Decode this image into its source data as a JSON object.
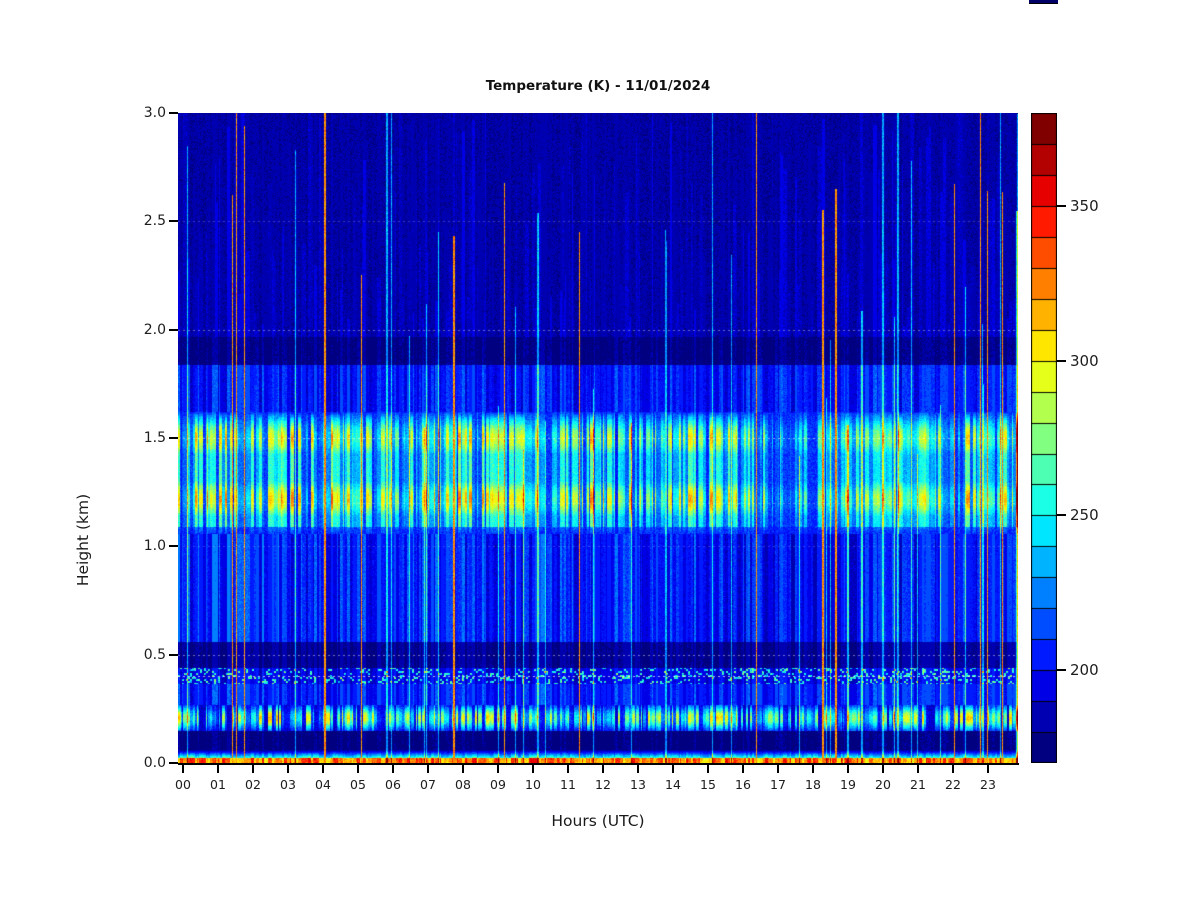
{
  "title": "Temperature (K) - 11/01/2024",
  "x_axis": {
    "label": "Hours (UTC)",
    "ticks": [
      "00",
      "01",
      "02",
      "03",
      "04",
      "05",
      "06",
      "07",
      "08",
      "09",
      "10",
      "11",
      "12",
      "13",
      "14",
      "15",
      "16",
      "17",
      "18",
      "19",
      "20",
      "21",
      "22",
      "23"
    ]
  },
  "y_axis": {
    "label": "Height (km)",
    "ticks": [
      "3.0",
      "2.5",
      "2.0",
      "1.5",
      "1.0",
      "0.5",
      "0.0"
    ]
  },
  "colorbar_ticks": [
    "350",
    "300",
    "250",
    "200"
  ],
  "artifact": {
    "top_edge_fragment_color": "#000066"
  },
  "chart_data": {
    "type": "heatmap",
    "title": "Temperature (K) - 11/01/2024",
    "xlabel": "Hours (UTC)",
    "ylabel": "Height (km)",
    "x_range_hours": [
      0,
      24
    ],
    "y_range_km": [
      0,
      3
    ],
    "x_tick_hours": [
      0,
      1,
      2,
      3,
      4,
      5,
      6,
      7,
      8,
      9,
      10,
      11,
      12,
      13,
      14,
      15,
      16,
      17,
      18,
      19,
      20,
      21,
      22,
      23
    ],
    "y_tick_km": [
      3.0,
      2.5,
      2.0,
      1.5,
      1.0,
      0.5,
      0.0
    ],
    "seed": 20241101,
    "colorbar": {
      "min": 170,
      "max": 380,
      "step": 10,
      "ticks": [
        350,
        300,
        250,
        200
      ],
      "palette": [
        "#000080",
        "#0000B3",
        "#0000E6",
        "#001AFF",
        "#004DFF",
        "#0080FF",
        "#00B3FF",
        "#00E6FF",
        "#1AFFE6",
        "#4DFFB3",
        "#80FF80",
        "#B3FF4D",
        "#E6FF1A",
        "#FFE600",
        "#FFB300",
        "#FF8000",
        "#FF4D00",
        "#FF1A00",
        "#E60000",
        "#B30000",
        "#800000"
      ]
    },
    "features": {
      "bands": [
        {
          "height_km": [
            0.0,
            0.026
          ],
          "desc": "surface hot layer",
          "temp_K": [
            298,
            355
          ]
        },
        {
          "height_km": [
            0.06,
            0.15
          ],
          "desc": "dark cold layer",
          "temp_K": [
            173,
            182
          ]
        },
        {
          "height_km": [
            0.15,
            0.27
          ],
          "desc": "speckled warm layer near 0.21 km",
          "temp_K": [
            190,
            325
          ]
        },
        {
          "height_km": [
            0.365,
            0.44
          ],
          "desc": "speckled cyan dots layer",
          "temp_K": [
            186,
            270
          ]
        },
        {
          "height_km": [
            0.44,
            0.56
          ],
          "desc": "dark cold layer",
          "temp_K": [
            174,
            186
          ]
        },
        {
          "height_km": [
            0.56,
            1.06
          ],
          "desc": "striped blue region, darker in evening",
          "temp_K": [
            182,
            230
          ]
        },
        {
          "height_km": [
            1.06,
            1.62
          ],
          "desc": "main warm band, hot cores near 1.22 and 1.50 km",
          "temp_K": [
            205,
            345
          ]
        },
        {
          "height_km": [
            1.62,
            1.84
          ],
          "desc": "striped blue region",
          "temp_K": [
            189,
            222
          ]
        },
        {
          "height_km": [
            1.84,
            1.97
          ],
          "desc": "dark cold layer",
          "temp_K": [
            173,
            183
          ]
        },
        {
          "height_km": [
            1.97,
            3.0
          ],
          "desc": "cold background with sparse bright thin columns",
          "temp_K": [
            178,
            250
          ]
        }
      ],
      "band_intensity_by_hour": [
        0.95,
        0.9,
        0.95,
        0.9,
        0.95,
        0.8,
        0.85,
        0.9,
        0.95,
        0.85,
        0.9,
        0.95,
        0.8,
        0.75,
        0.9,
        0.95,
        0.7,
        0.55,
        0.55,
        0.7,
        0.8,
        0.75,
        0.85,
        0.8
      ],
      "low_band_intensity_by_hour": [
        0.9,
        0.85,
        0.9,
        0.8,
        0.85,
        0.8,
        0.75,
        0.8,
        0.85,
        0.8,
        0.75,
        0.8,
        0.7,
        0.75,
        0.8,
        0.85,
        0.7,
        0.65,
        0.75,
        0.85,
        0.9,
        0.85,
        0.9,
        0.85
      ],
      "subkm_darkness_by_hour": [
        0.2,
        0.2,
        0.25,
        0.3,
        0.3,
        0.35,
        0.3,
        0.3,
        0.35,
        0.4,
        0.35,
        0.3,
        0.4,
        0.45,
        0.4,
        0.45,
        0.65,
        0.8,
        0.8,
        0.7,
        0.6,
        0.55,
        0.5,
        0.55
      ],
      "gridlines_km": [
        {
          "h": 0.4,
          "alpha": 0.7
        },
        {
          "h": 0.5,
          "alpha": 0.45
        },
        {
          "h": 1.0,
          "alpha": 0.2
        },
        {
          "h": 1.2,
          "alpha": 0.3
        },
        {
          "h": 1.5,
          "alpha": 0.5
        },
        {
          "h": 2.0,
          "alpha": 0.4
        },
        {
          "h": 2.5,
          "alpha": 0.22
        }
      ]
    }
  }
}
